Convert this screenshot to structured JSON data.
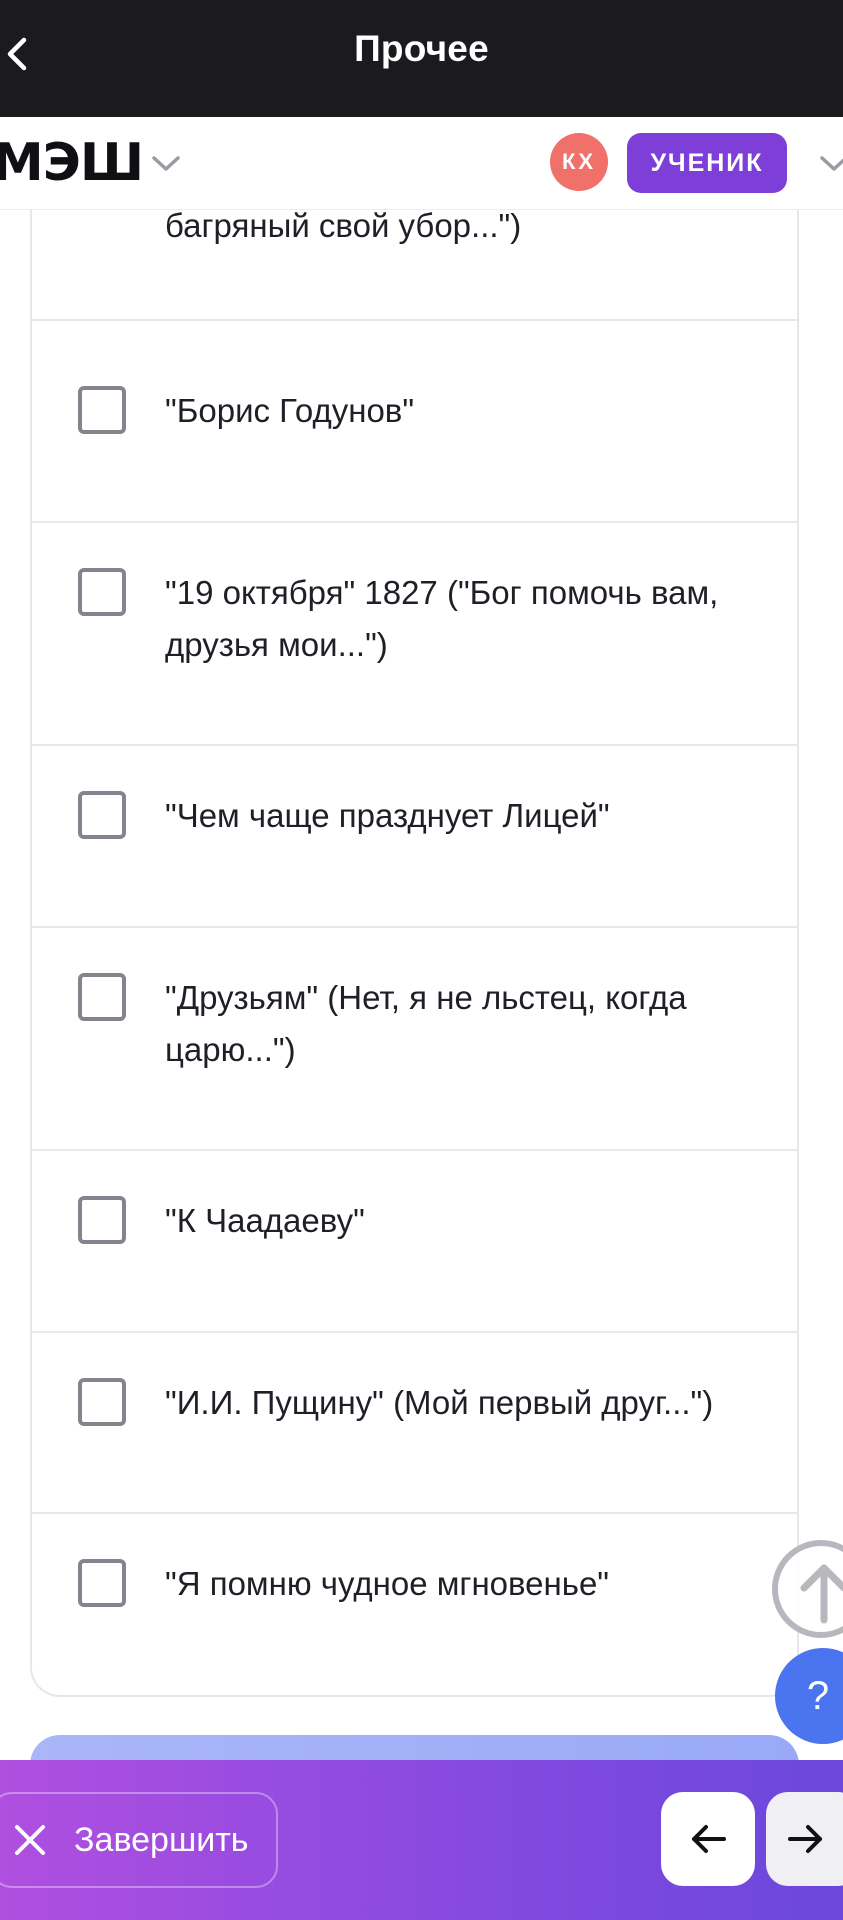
{
  "topbar": {
    "title": "Прочее"
  },
  "header": {
    "logo": "МЭШ",
    "avatar_initials": "КХ",
    "role_label": "УЧЕНИК",
    "avatar_color": "#f0706a",
    "role_color": "#7e3fd9"
  },
  "options": [
    {
      "label": "багряный свой убор...\")",
      "checked": false
    },
    {
      "label": "\"Борис Годунов\"",
      "checked": false
    },
    {
      "label": "\"19 октября\" 1827 (\"Бог помочь вам, друзья мои...\")",
      "checked": false
    },
    {
      "label": "\"Чем чаще празднует Лицей\"",
      "checked": false
    },
    {
      "label": "\"Друзьям\" (Нет, я не льстец, когда царю...\")",
      "checked": false
    },
    {
      "label": "\"К Чаадаеву\"",
      "checked": false
    },
    {
      "label": "\"И.И. Пущину\" (Мой первый друг...\")",
      "checked": false
    },
    {
      "label": "\"Я помню чудное мгновенье\"",
      "checked": false
    }
  ],
  "floating": {
    "help_label": "?"
  },
  "footer": {
    "finish_label": "Завершить",
    "gradient_start": "#b04fe0",
    "gradient_end": "#6b47dc"
  }
}
